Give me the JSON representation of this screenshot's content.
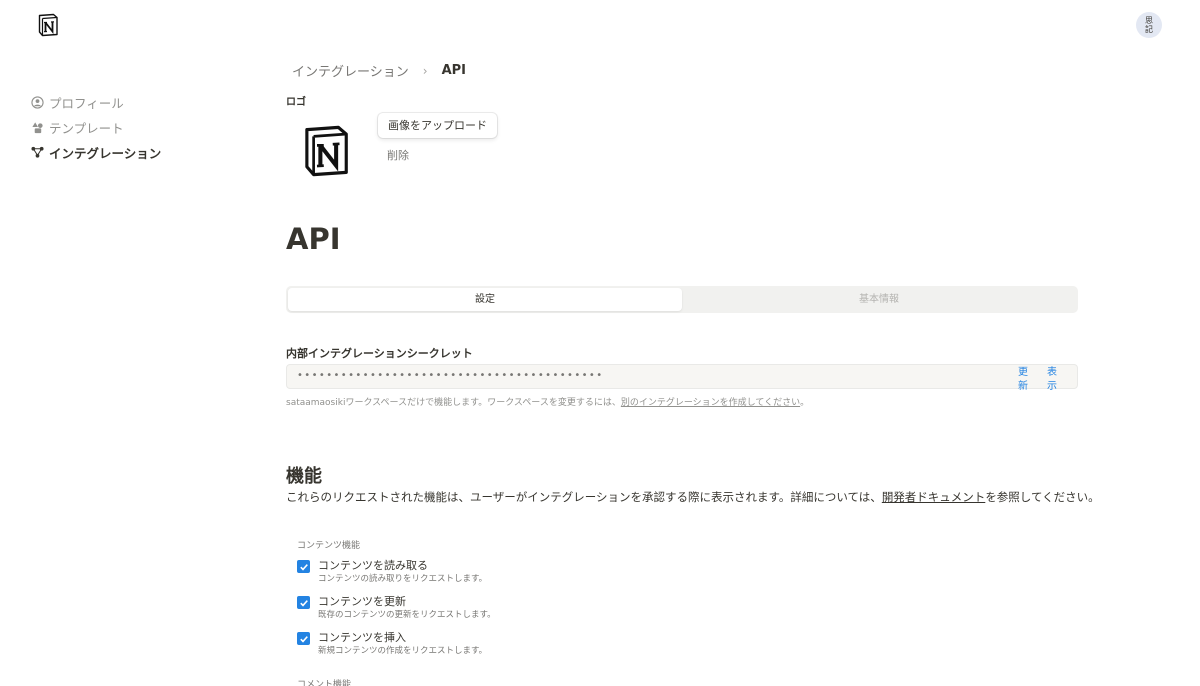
{
  "app": {
    "logo_icon": "notion-logo-icon",
    "avatar_text": [
      "思",
      "記"
    ]
  },
  "sidebar": {
    "items": [
      {
        "label": "プロフィール",
        "icon": "person-circle-icon",
        "active": false
      },
      {
        "label": "テンプレート",
        "icon": "shapes-icon",
        "active": false
      },
      {
        "label": "インテグレーション",
        "icon": "integration-nodes-icon",
        "active": true
      }
    ]
  },
  "breadcrumb": {
    "parent": "インテグレーション",
    "separator": "›",
    "current": "API"
  },
  "logo_section": {
    "label": "ロゴ",
    "upload_label": "画像をアップロード",
    "delete_label": "削除"
  },
  "page": {
    "title": "API"
  },
  "tabs": [
    {
      "label": "設定",
      "active": true
    },
    {
      "label": "基本情報",
      "active": false
    }
  ],
  "secret": {
    "label": "内部インテグレーションシークレット",
    "masked_value": "••••••••••••••••••••••••••••••••••••••••••",
    "refresh_label": [
      "更",
      "新"
    ],
    "show_label": [
      "表",
      "示"
    ],
    "note_prefix": "sataamaosikiワークスペースだけで機能します。ワークスペースを変更するには、",
    "note_link": "別のインテグレーションを作成してください",
    "note_suffix": "。"
  },
  "capabilities": {
    "title": "機能",
    "desc_prefix": "これらのリクエストされた機能は、ユーザーがインテグレーションを承認する際に表示されます。詳細については、",
    "desc_link": "開発者ドキュメント",
    "desc_suffix": "を参照してください。",
    "content_group": {
      "label": "コンテンツ機能",
      "items": [
        {
          "title": "コンテンツを読み取る",
          "desc": "コンテンツの読み取りをリクエストします。",
          "checked": true
        },
        {
          "title": "コンテンツを更新",
          "desc": "既存のコンテンツの更新をリクエストします。",
          "checked": true
        },
        {
          "title": "コンテンツを挿入",
          "desc": "新規コンテンツの作成をリクエストします。",
          "checked": true
        }
      ]
    },
    "comment_group": {
      "label": "コメント機能"
    }
  },
  "colors": {
    "accent": "#2383e2",
    "text": "#37352f",
    "muted": "#787774"
  }
}
